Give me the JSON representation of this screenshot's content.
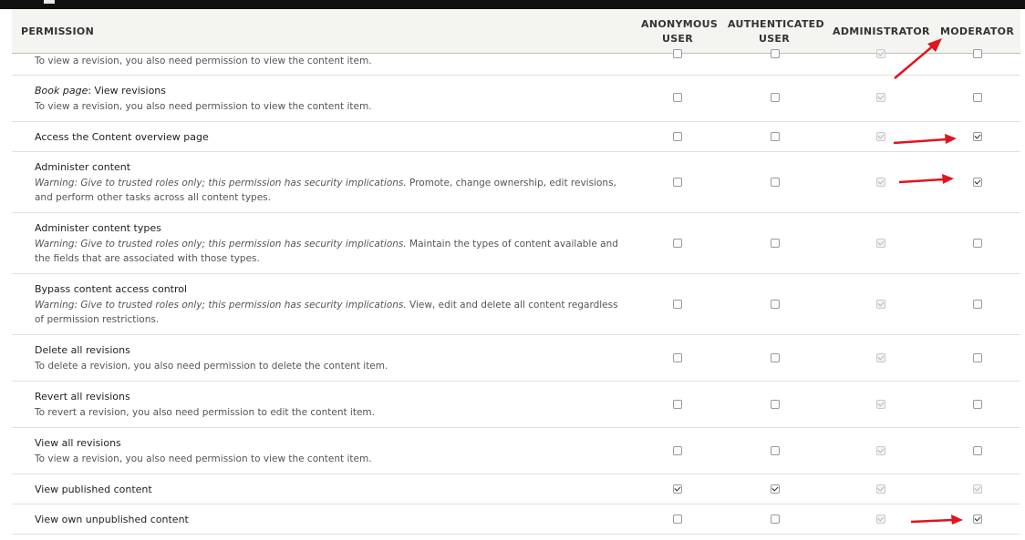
{
  "header": {
    "permission": "PERMISSION",
    "anonymous_line1": "ANONYMOUS",
    "anonymous_line2": "USER",
    "authenticated_line1": "AUTHENTICATED",
    "authenticated_line2": "USER",
    "administrator": "ADMINISTRATOR",
    "moderator": "MODERATOR"
  },
  "rows": [
    {
      "desc": "To view a revision, you also need permission to view the content item."
    },
    {
      "prefix": "Book page",
      "title": ": View revisions",
      "desc": "To view a revision, you also need permission to view the content item."
    },
    {
      "title": "Access the Content overview page"
    },
    {
      "title": "Administer content",
      "warning": "Warning: Give to trusted roles only; this permission has security implications.",
      "desc": " Promote, change ownership, edit revisions, and perform other tasks across all content types."
    },
    {
      "title": "Administer content types",
      "warning": "Warning: Give to trusted roles only; this permission has security implications.",
      "desc": " Maintain the types of content available and the fields that are associated with those types."
    },
    {
      "title": "Bypass content access control",
      "warning": "Warning: Give to trusted roles only; this permission has security implications.",
      "desc": " View, edit and delete all content regardless of permission restrictions."
    },
    {
      "title": "Delete all revisions",
      "desc": "To delete a revision, you also need permission to delete the content item."
    },
    {
      "title": "Revert all revisions",
      "desc": "To revert a revision, you also need permission to edit the content item."
    },
    {
      "title": "View all revisions",
      "desc": "To view a revision, you also need permission to view the content item."
    },
    {
      "title": "View published content"
    },
    {
      "title": "View own unpublished content"
    }
  ],
  "checkbox_states": {
    "row0": [
      "unchecked",
      "unchecked",
      "disabled",
      "unchecked"
    ],
    "row1": [
      "unchecked",
      "unchecked",
      "disabled",
      "unchecked"
    ],
    "row2": [
      "unchecked",
      "unchecked",
      "disabled",
      "checked"
    ],
    "row3": [
      "unchecked",
      "unchecked",
      "disabled",
      "checked"
    ],
    "row4": [
      "unchecked",
      "unchecked",
      "disabled",
      "unchecked"
    ],
    "row5": [
      "unchecked",
      "unchecked",
      "disabled",
      "unchecked"
    ],
    "row6": [
      "unchecked",
      "unchecked",
      "disabled",
      "unchecked"
    ],
    "row7": [
      "unchecked",
      "unchecked",
      "disabled",
      "unchecked"
    ],
    "row8": [
      "unchecked",
      "unchecked",
      "disabled",
      "unchecked"
    ],
    "row9": [
      "checked",
      "checked",
      "disabled",
      "disabled"
    ],
    "row10": [
      "unchecked",
      "unchecked",
      "disabled",
      "checked"
    ]
  },
  "annotation_color": "#e0141e"
}
